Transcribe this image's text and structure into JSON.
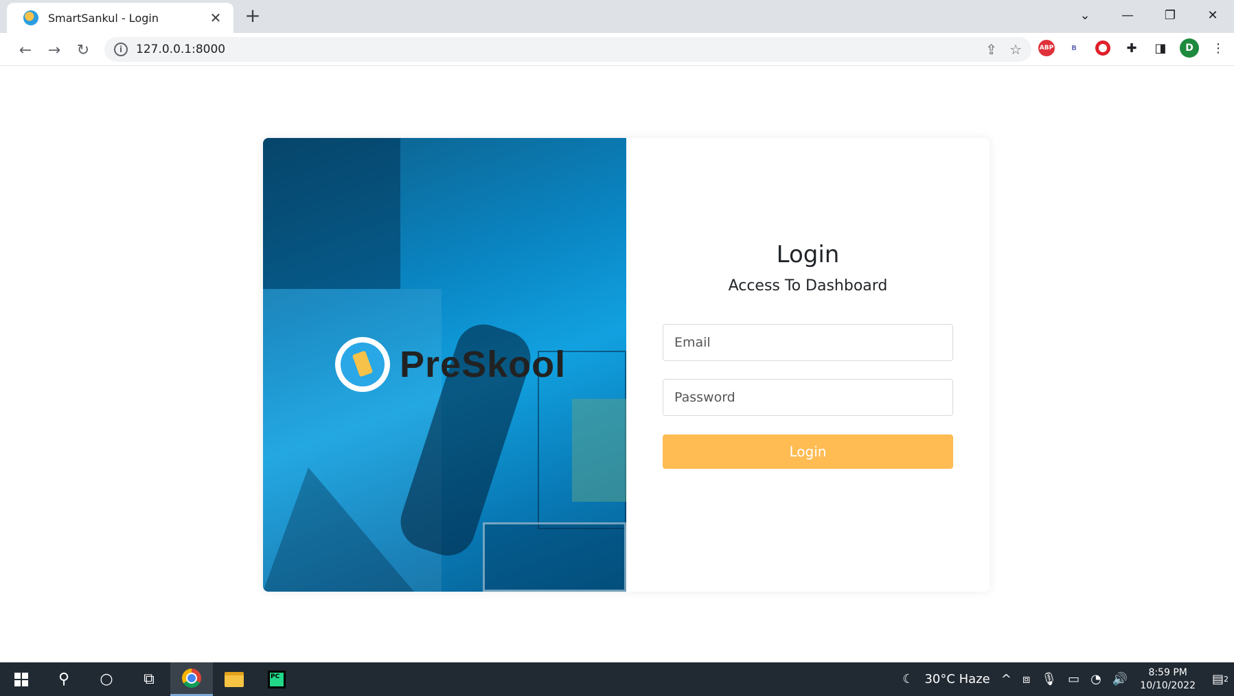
{
  "browser": {
    "tab_title": "SmartSankul - Login",
    "tab_close": "✕",
    "new_tab": "+",
    "url": "127.0.0.1:8000",
    "window_controls": [
      "⌄",
      "—",
      "❐",
      "✕"
    ],
    "extensions": {
      "abp": "ABP",
      "b": "B",
      "avatar_initial": "D"
    }
  },
  "login": {
    "brand": "PreSkool",
    "title": "Login",
    "subtitle": "Access To Dashboard",
    "email_placeholder": "Email",
    "password_placeholder": "Password",
    "button_label": "Login",
    "accent_color": "#ffbc53"
  },
  "taskbar": {
    "weather": "30°C  Haze",
    "time": "8:59 PM",
    "date": "10/10/2022",
    "notification_count": "2"
  }
}
